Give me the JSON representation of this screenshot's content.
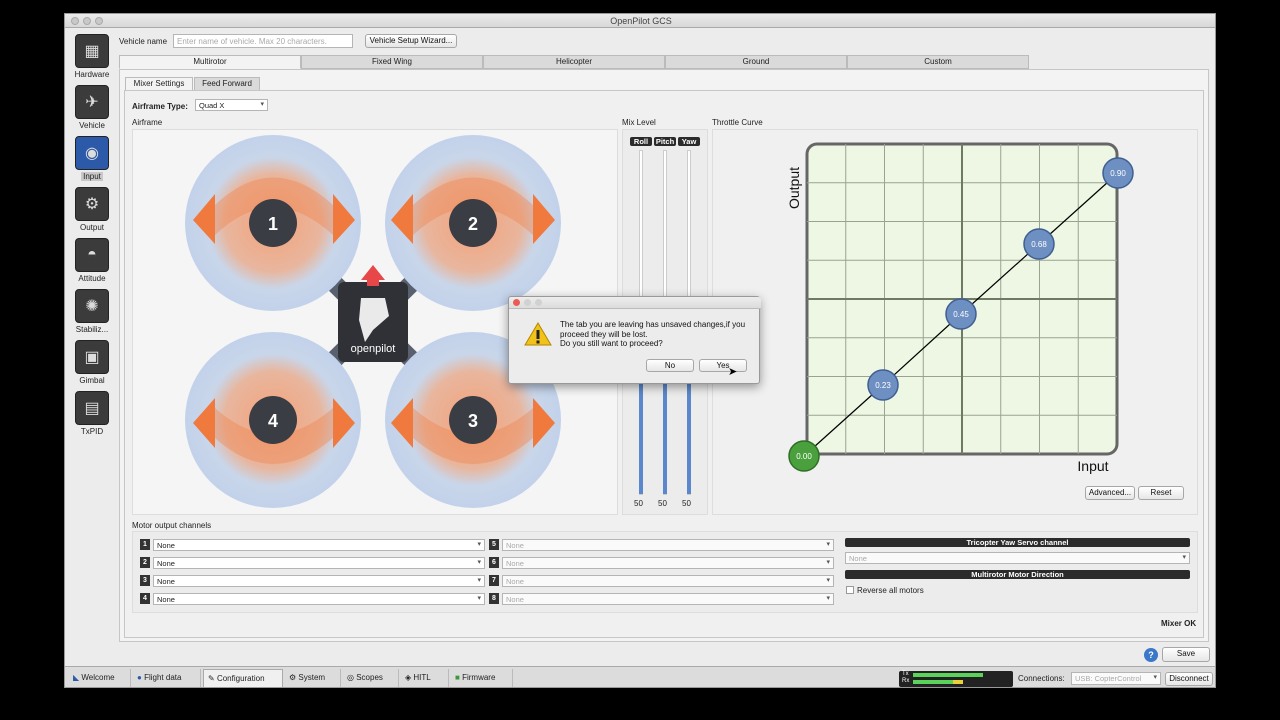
{
  "window": {
    "title": "OpenPilot GCS"
  },
  "sidebar": {
    "items": [
      {
        "label": "Hardware",
        "icon": "chip-icon"
      },
      {
        "label": "Vehicle",
        "icon": "vehicle-icon"
      },
      {
        "label": "Input",
        "icon": "transmitter-icon",
        "active": true
      },
      {
        "label": "Output",
        "icon": "motor-icon"
      },
      {
        "label": "Attitude",
        "icon": "attitude-icon"
      },
      {
        "label": "Stabiliz...",
        "icon": "gyro-icon"
      },
      {
        "label": "Gimbal",
        "icon": "camera-icon"
      },
      {
        "label": "TxPID",
        "icon": "txpid-icon"
      }
    ]
  },
  "header": {
    "vehicle_name_label": "Vehicle name",
    "vehicle_name_placeholder": "Enter name of vehicle. Max 20 characters.",
    "wizard_button": "Vehicle Setup Wizard..."
  },
  "vehicle_tabs": [
    "Multirotor",
    "Fixed Wing",
    "Helicopter",
    "Ground",
    "Custom"
  ],
  "sub_tabs": [
    "Mixer Settings",
    "Feed Forward"
  ],
  "airframe": {
    "type_label": "Airframe Type:",
    "type_value": "Quad X",
    "section_label": "Airframe",
    "motors": [
      "1",
      "2",
      "3",
      "4"
    ],
    "logo_text": "openpilot"
  },
  "mix_level": {
    "label": "Mix Level",
    "columns": [
      "Roll",
      "Pitch",
      "Yaw"
    ],
    "values": [
      "50",
      "50",
      "50"
    ]
  },
  "throttle_curve": {
    "label": "Throttle Curve",
    "ylabel": "Output",
    "xlabel": "Input",
    "points": [
      "0.00",
      "0.23",
      "0.45",
      "0.68",
      "0.90"
    ],
    "advanced_button": "Advanced...",
    "reset_button": "Reset"
  },
  "motor_output": {
    "label": "Motor output channels",
    "channels": [
      {
        "n": "1",
        "value": "None"
      },
      {
        "n": "2",
        "value": "None"
      },
      {
        "n": "3",
        "value": "None"
      },
      {
        "n": "4",
        "value": "None"
      },
      {
        "n": "5",
        "value": "None"
      },
      {
        "n": "6",
        "value": "None"
      },
      {
        "n": "7",
        "value": "None"
      },
      {
        "n": "8",
        "value": "None"
      }
    ],
    "tricopter_label": "Tricopter Yaw Servo channel",
    "tricopter_value": "None",
    "direction_label": "Multirotor Motor Direction",
    "reverse_label": "Reverse all motors",
    "status": "Mixer OK"
  },
  "dialog": {
    "message": "The tab you are leaving has unsaved changes,if you proceed they will be lost.\nDo you still want to proceed?",
    "no_button": "No",
    "yes_button": "Yes"
  },
  "save_button": "Save",
  "help_icon": "?",
  "bottom_tabs": [
    "Welcome",
    "Flight data",
    "Configuration",
    "System",
    "Scopes",
    "HITL",
    "Firmware"
  ],
  "status": {
    "tx_label": "Tx",
    "rx_label": "Rx",
    "connections_label": "Connections:",
    "connection_value": "USB: CopterControl",
    "disconnect_button": "Disconnect"
  },
  "colors": {
    "accent": "#2d5aa8",
    "arrow_orange": "#f07a3e",
    "curve_node": "#6d8fc2",
    "start_node": "#4aa03c",
    "grid_bg": "#eef6e4"
  }
}
